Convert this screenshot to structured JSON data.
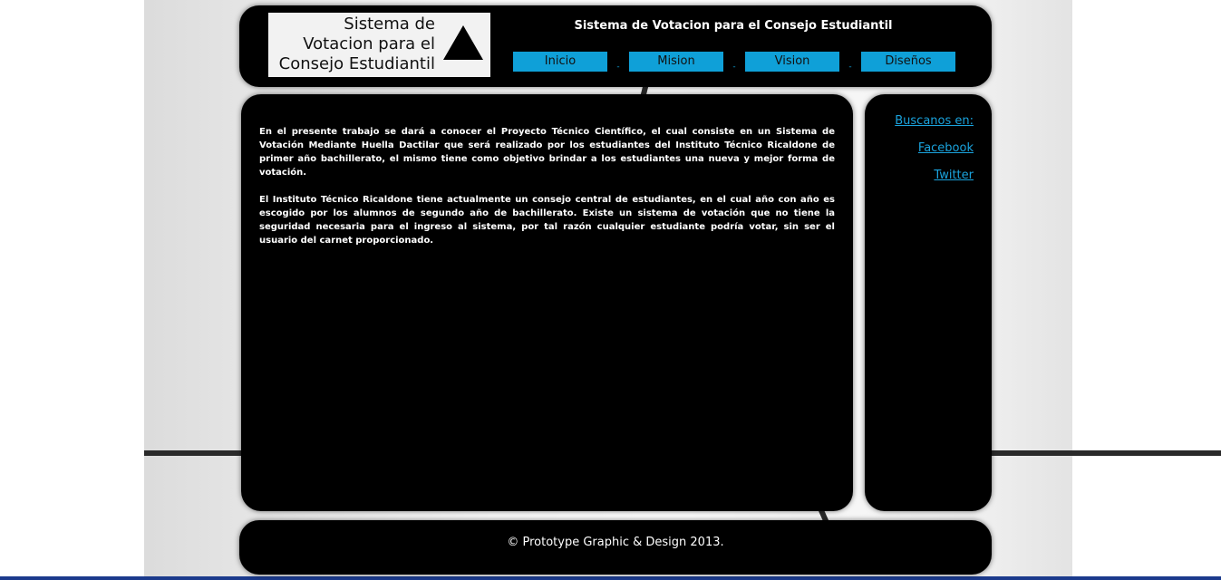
{
  "header": {
    "logo_text": "Sistema de Votacion para el Consejo Estudiantil",
    "title": "Sistema de Votacion para el Consejo Estudiantil",
    "nav": [
      {
        "label": "Inicio"
      },
      {
        "label": "Mision"
      },
      {
        "label": "Vision"
      },
      {
        "label": "Diseños"
      }
    ],
    "nav_separator": "-"
  },
  "main": {
    "paragraphs": [
      "En el presente trabajo se dará a conocer el Proyecto Técnico Científico, el cual consiste en un Sistema de Votación Mediante Huella Dactilar que será realizado por los estudiantes del Instituto Técnico Ricaldone de primer año bachillerato, el mismo tiene como objetivo brindar a los estudiantes una nueva y mejor forma de votación.",
      "El Instituto Técnico Ricaldone tiene actualmente un consejo central de estudiantes, en el cual año con año es escogido por los alumnos de segundo año de bachillerato. Existe un sistema de votación que no tiene la seguridad necesaria para el ingreso al sistema, por tal razón cualquier estudiante podría votar, sin ser el usuario del carnet proporcionado."
    ]
  },
  "aside": {
    "links": [
      {
        "label": "Buscanos en:"
      },
      {
        "label": "Facebook"
      },
      {
        "label": "Twitter"
      }
    ]
  },
  "footer": {
    "copyright": "© Prototype Graphic & Design 2013."
  },
  "colors": {
    "accent": "#0fa0d8",
    "link": "#1aa3dd",
    "panel": "#000000"
  },
  "icons": {
    "logo_mark": "triangle-icon"
  }
}
